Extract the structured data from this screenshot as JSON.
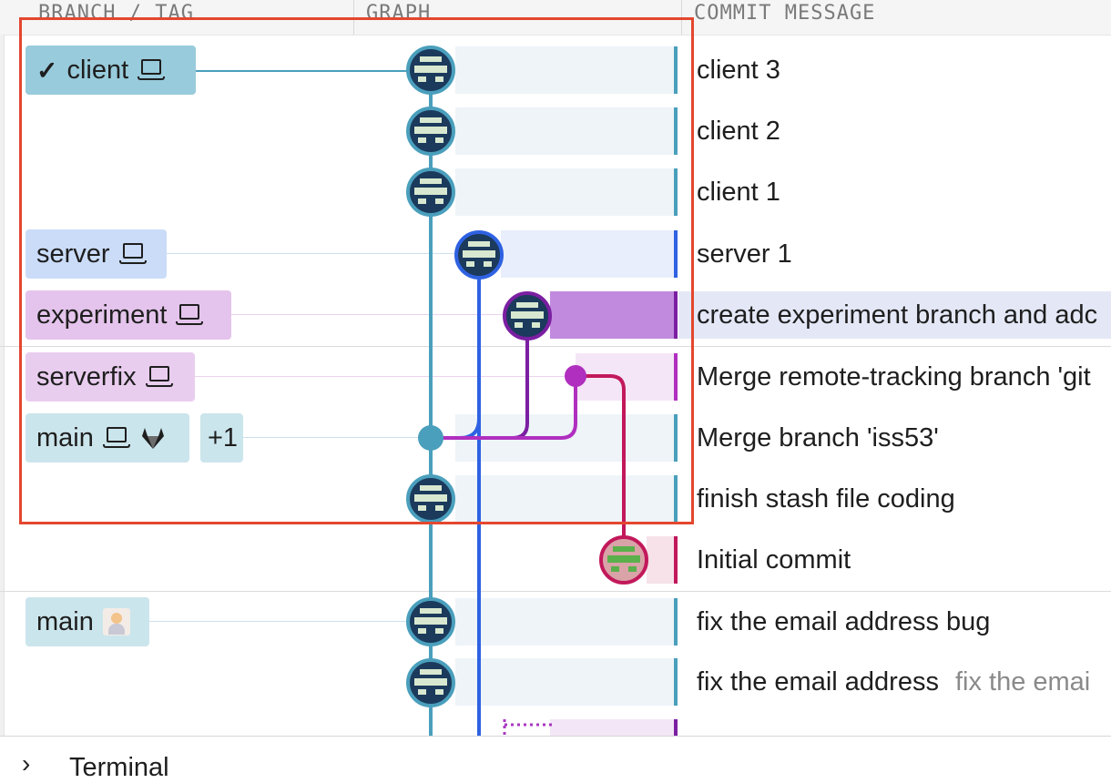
{
  "header": {
    "branch_col": "BRANCH / TAG",
    "graph_col": "GRAPH",
    "message_col": "COMMIT MESSAGE"
  },
  "colors": {
    "client": "#4a9fbc",
    "server": "#2f62e2",
    "experiment": "#7b1fa2",
    "serverfix": "#b02fbf",
    "initial": "#c2185b",
    "highlight": "#e4472f",
    "avatar": "#1b3a5c"
  },
  "refs": {
    "client": "client",
    "server": "server",
    "experiment": "experiment",
    "serverfix": "serverfix",
    "main": "main",
    "main_extra": "+1",
    "main_remote": "main"
  },
  "icons": {
    "current_branch": "checkmark-icon",
    "local": "laptop-icon",
    "remote": "gitlab-icon",
    "remote_user": "user-avatar-icon"
  },
  "commits": [
    {
      "message": "client 3"
    },
    {
      "message": "client 2"
    },
    {
      "message": "client 1"
    },
    {
      "message": "server 1"
    },
    {
      "message": "create experiment branch and adc"
    },
    {
      "message": "Merge remote-tracking branch 'git"
    },
    {
      "message": "Merge branch 'iss53'"
    },
    {
      "message": "finish stash file coding"
    },
    {
      "message": "Initial commit"
    },
    {
      "message": "fix the email address bug"
    },
    {
      "message": "fix the email address",
      "description": "fix the emai"
    }
  ],
  "terminal": {
    "label": "Terminal"
  }
}
